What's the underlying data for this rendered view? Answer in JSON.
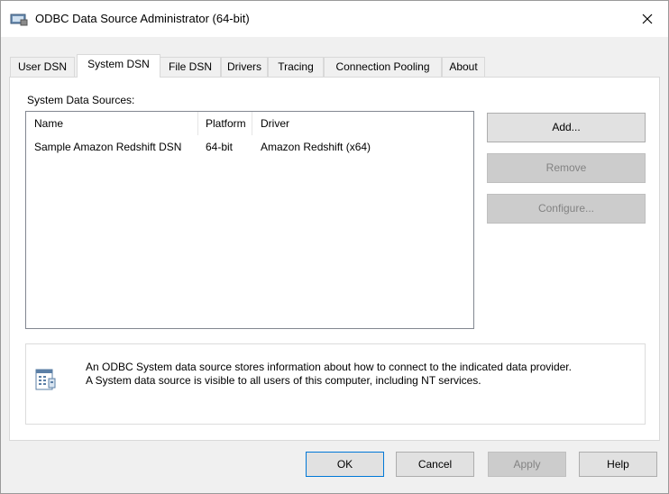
{
  "window": {
    "title": "ODBC Data Source Administrator (64-bit)"
  },
  "tabs": [
    {
      "label": "User DSN"
    },
    {
      "label": "System DSN"
    },
    {
      "label": "File DSN"
    },
    {
      "label": "Drivers"
    },
    {
      "label": "Tracing"
    },
    {
      "label": "Connection Pooling"
    },
    {
      "label": "About"
    }
  ],
  "active_tab": "System DSN",
  "system_data_sources": {
    "label": "System Data Sources:",
    "columns": [
      "Name",
      "Platform",
      "Driver"
    ],
    "rows": [
      {
        "name": "Sample Amazon Redshift DSN",
        "platform": "64-bit",
        "driver": "Amazon Redshift (x64)"
      }
    ]
  },
  "side_buttons": {
    "add": "Add...",
    "remove": "Remove",
    "configure": "Configure..."
  },
  "info": {
    "line1": "An ODBC System data source stores information about how to connect to the indicated data provider.",
    "line2": "A System data source is visible to all users of this computer, including NT services."
  },
  "footer_buttons": {
    "ok": "OK",
    "cancel": "Cancel",
    "apply": "Apply",
    "help": "Help"
  },
  "icons": {
    "app": "odbc-admin-icon",
    "close": "close-icon",
    "info": "data-source-icon"
  },
  "colors": {
    "focus_border": "#0078d7",
    "disabled_text": "#838383"
  }
}
